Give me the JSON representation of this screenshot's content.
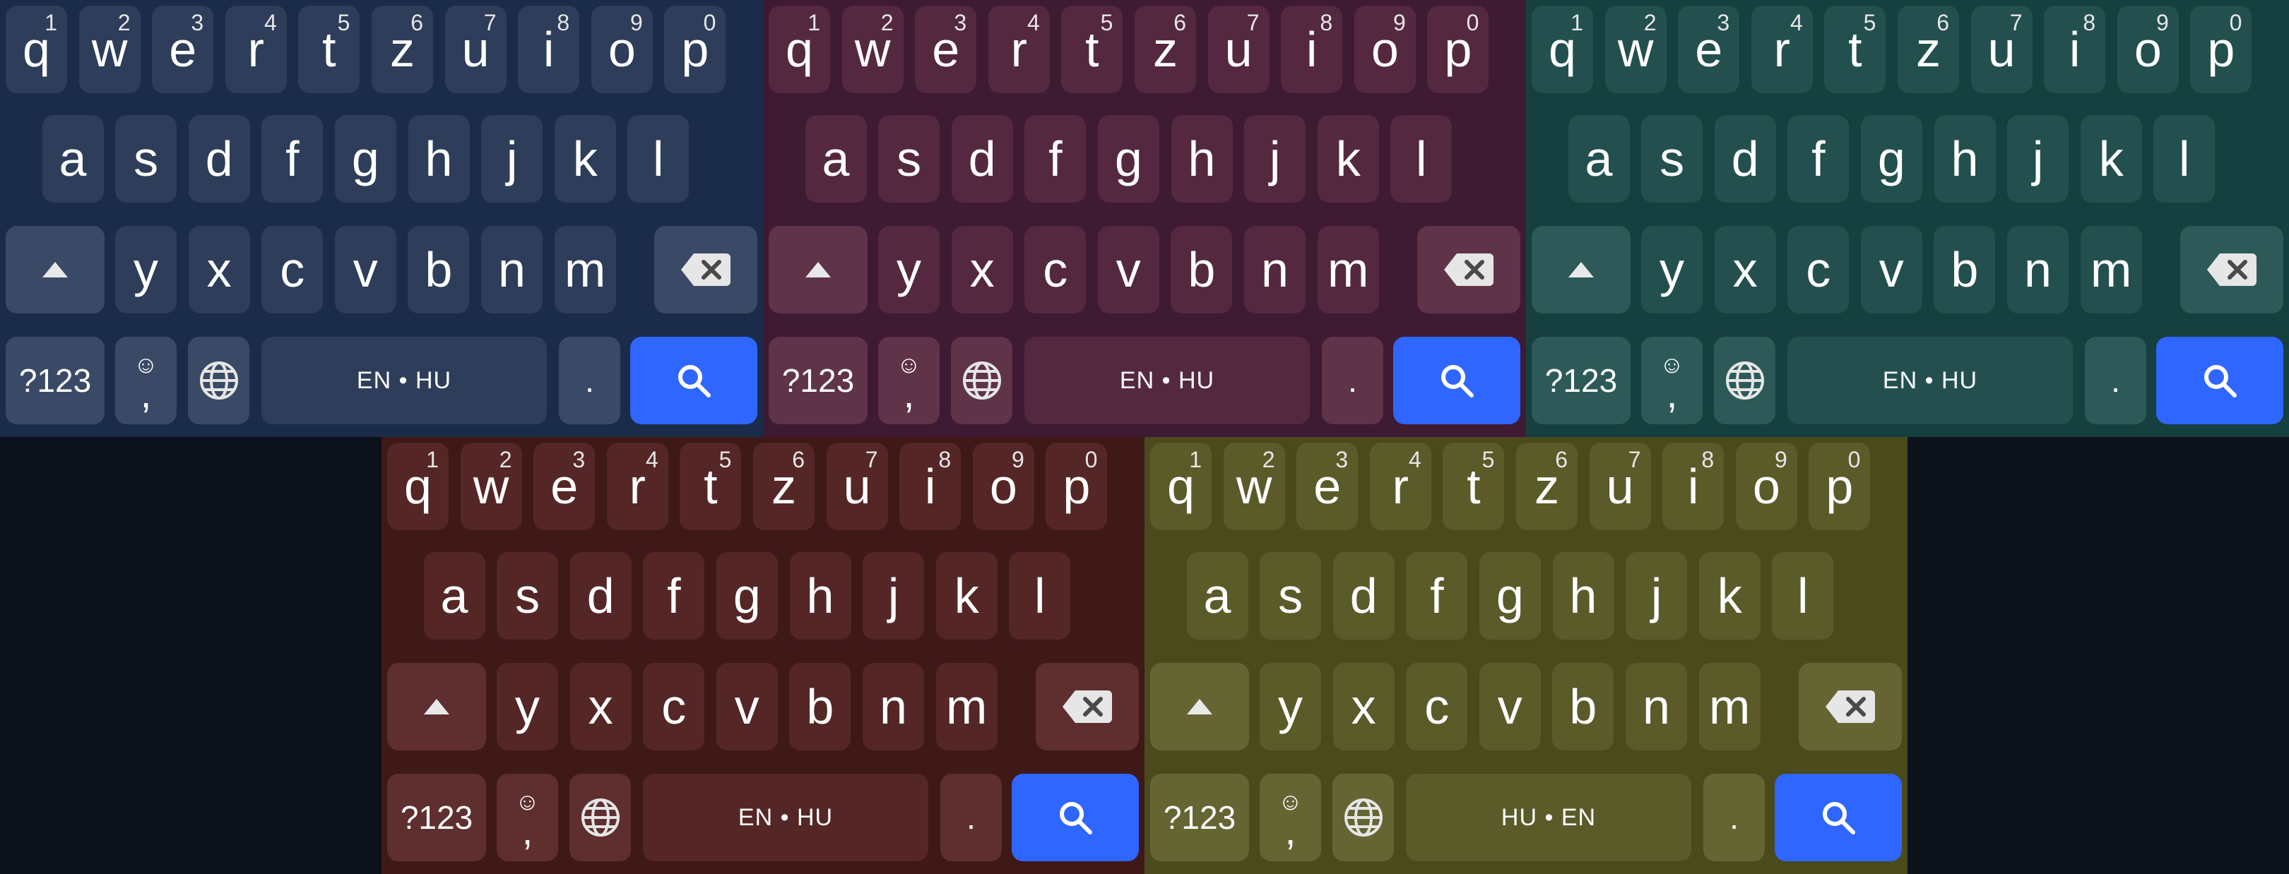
{
  "keyboards": [
    {
      "id": "kb-0",
      "colors": {
        "bg": "#1b2c4a",
        "key": "#2d3d5a",
        "special": "#3a4a66"
      },
      "lang_label": "EN • HU"
    },
    {
      "id": "kb-1",
      "colors": {
        "bg": "#3e1a33",
        "key": "#54293f",
        "special": "#5f3348"
      },
      "lang_label": "EN • HU"
    },
    {
      "id": "kb-2",
      "colors": {
        "bg": "#163f3f",
        "key": "#23504e",
        "special": "#2d5a58"
      },
      "lang_label": "EN • HU"
    },
    {
      "id": "kb-3",
      "colors": {
        "bg": "#3f1818",
        "key": "#552626",
        "special": "#5f2f2f"
      },
      "lang_label": "EN • HU"
    },
    {
      "id": "kb-4",
      "colors": {
        "bg": "#4a4a1c",
        "key": "#5b5b2a",
        "special": "#656533"
      },
      "lang_label": "HU • EN"
    }
  ],
  "layout": {
    "row1": [
      "q",
      "w",
      "e",
      "r",
      "t",
      "z",
      "u",
      "i",
      "o",
      "p"
    ],
    "row1_hints": [
      "1",
      "2",
      "3",
      "4",
      "5",
      "6",
      "7",
      "8",
      "9",
      "0"
    ],
    "row2": [
      "a",
      "s",
      "d",
      "f",
      "g",
      "h",
      "j",
      "k",
      "l"
    ],
    "row3": [
      "y",
      "x",
      "c",
      "v",
      "b",
      "n",
      "m"
    ],
    "symbols_label": "?123",
    "emoji_face": "☺",
    "comma": ",",
    "period": ".",
    "icons": {
      "shift": "shift-arrow-icon",
      "backspace": "backspace-icon",
      "globe": "globe-icon",
      "search": "search-icon"
    },
    "accent_color": "#2f66ff"
  }
}
